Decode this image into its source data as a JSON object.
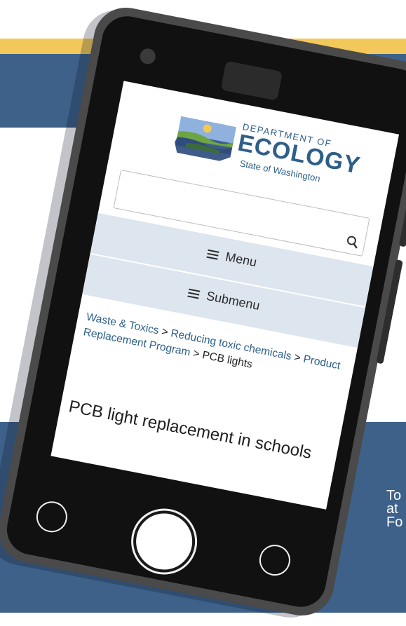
{
  "page": {
    "side_text": "To\nat\nFo"
  },
  "logo": {
    "line1": "DEPARTMENT OF",
    "line2": "ECOLOGY",
    "line3": "State of Washington"
  },
  "search": {
    "placeholder": "",
    "icon": "search-icon"
  },
  "nav": {
    "menu_label": "Menu",
    "submenu_label": "Submenu"
  },
  "breadcrumb": {
    "items": [
      "Waste & Toxics",
      "Reducing toxic chemicals",
      "Product Replacement Program",
      "PCB lights"
    ],
    "separator": " > "
  },
  "main": {
    "title": "PCB light replacement in schools"
  },
  "colors": {
    "gold": "#f3c85b",
    "blue": "#3d6189",
    "nav_bg": "#dde5ee",
    "link": "#2c5f88"
  }
}
